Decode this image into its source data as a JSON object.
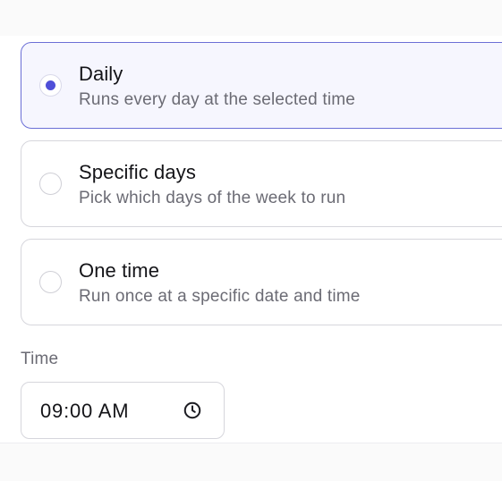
{
  "schedule_options": [
    {
      "title": "Daily",
      "description": "Runs every day at the selected time",
      "selected": true
    },
    {
      "title": "Specific days",
      "description": "Pick which days of the week to run",
      "selected": false
    },
    {
      "title": "One time",
      "description": "Run once at a specific date and time",
      "selected": false
    }
  ],
  "time_field": {
    "label": "Time",
    "value": "09:00 AM",
    "icon": "clock-icon"
  },
  "colors": {
    "accent": "#4f4fd8",
    "selected_border": "#6b6fd6",
    "selected_background": "#f6f6fe"
  }
}
